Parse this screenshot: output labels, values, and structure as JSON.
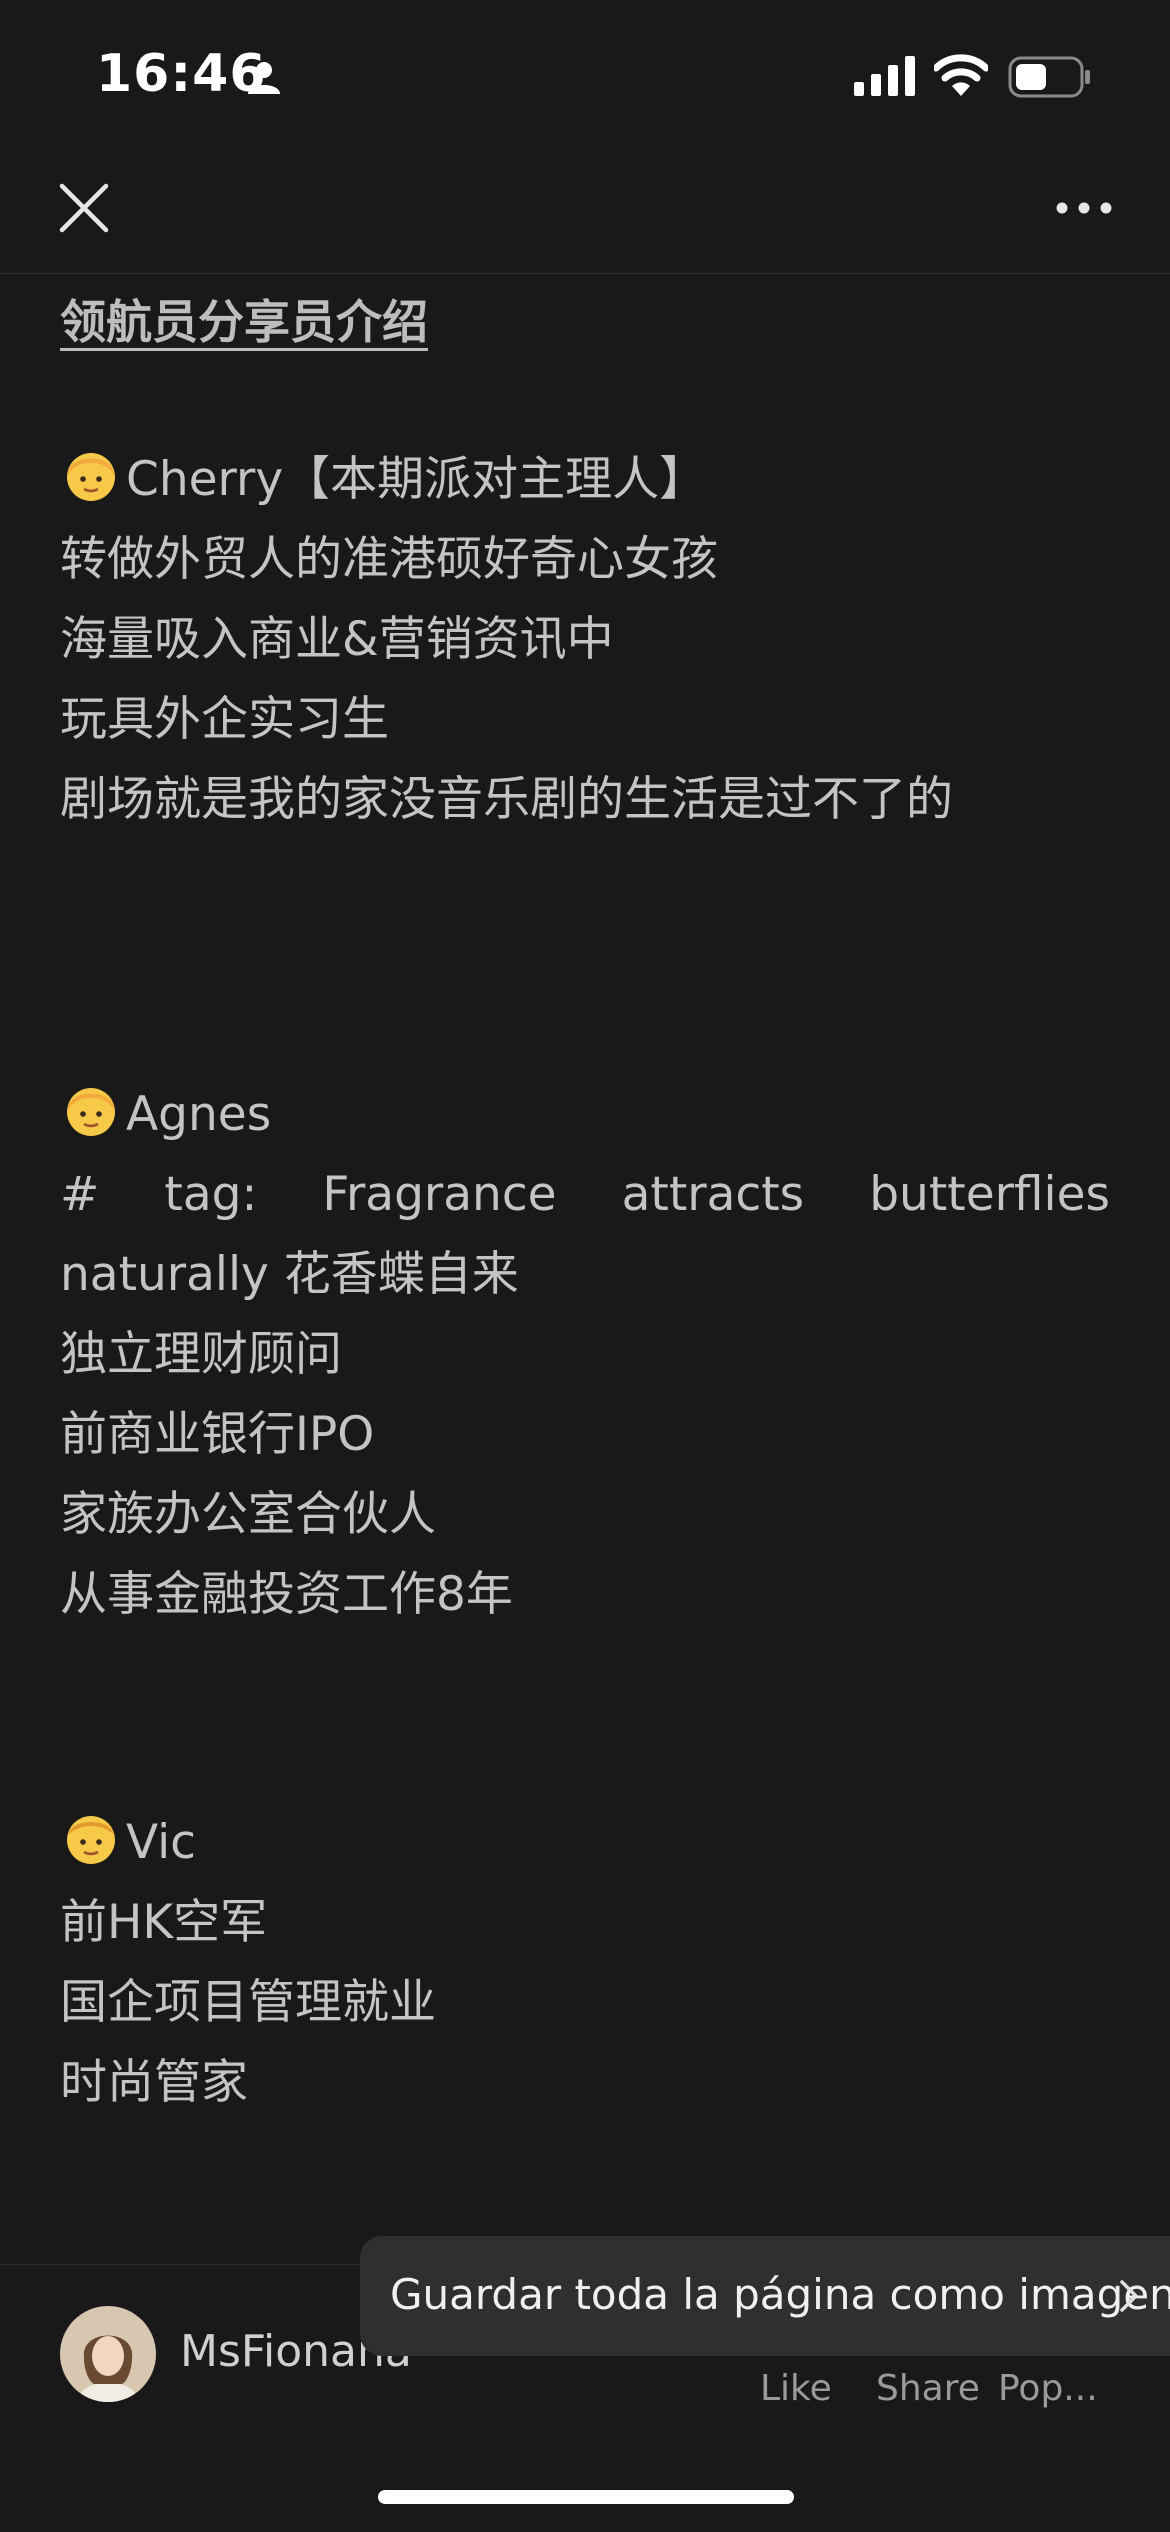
{
  "status_bar": {
    "time": "16:46"
  },
  "article": {
    "heading": "领航员分享员介绍",
    "sections": [
      {
        "name": "Cherry【本期派对主理人】",
        "lines": [
          "转做外贸人的准港硕好奇心女孩",
          "海量吸入商业&营销资讯中",
          "玩具外企实习生",
          "剧场就是我的家没音乐剧的生活是过不了的"
        ]
      },
      {
        "name": "Agnes",
        "lines": [
          "# tag: Fragrance attracts butterflies",
          "naturally 花香蝶自来",
          "独立理财顾问",
          "前商业银行IPO",
          "家族办公室合伙人",
          "从事金融投资工作8年"
        ]
      },
      {
        "name": "Vic",
        "lines": [
          "前HK空军",
          "国企项目管理就业",
          "时尚管家"
        ]
      }
    ]
  },
  "footer": {
    "author": "MsFionana",
    "like_label": "Like",
    "share_label": "Share",
    "pop_label": "Pop..."
  },
  "toast": {
    "text": "Guardar toda la página como imagen"
  },
  "colors": {
    "background": "#191919",
    "text": "#c4c4c4",
    "toast_bg": "#2f2f2f"
  }
}
